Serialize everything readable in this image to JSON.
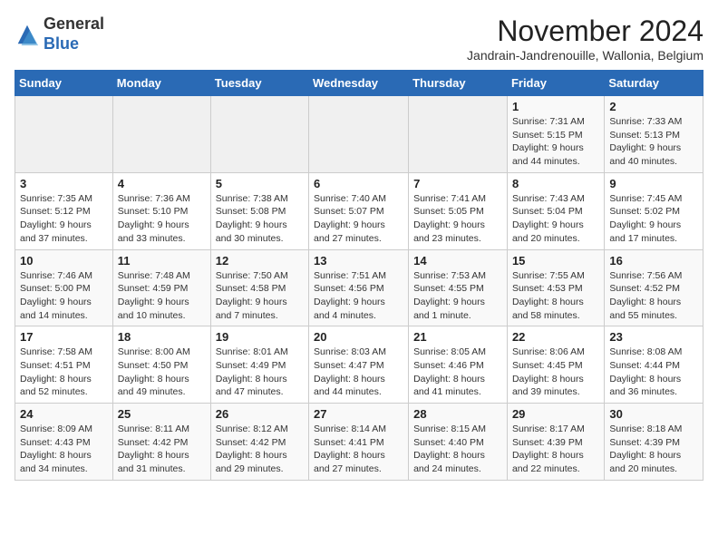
{
  "logo": {
    "general": "General",
    "blue": "Blue"
  },
  "title": "November 2024",
  "subtitle": "Jandrain-Jandrenouille, Wallonia, Belgium",
  "days_header": [
    "Sunday",
    "Monday",
    "Tuesday",
    "Wednesday",
    "Thursday",
    "Friday",
    "Saturday"
  ],
  "weeks": [
    [
      {
        "day": "",
        "info": ""
      },
      {
        "day": "",
        "info": ""
      },
      {
        "day": "",
        "info": ""
      },
      {
        "day": "",
        "info": ""
      },
      {
        "day": "",
        "info": ""
      },
      {
        "day": "1",
        "info": "Sunrise: 7:31 AM\nSunset: 5:15 PM\nDaylight: 9 hours\nand 44 minutes."
      },
      {
        "day": "2",
        "info": "Sunrise: 7:33 AM\nSunset: 5:13 PM\nDaylight: 9 hours\nand 40 minutes."
      }
    ],
    [
      {
        "day": "3",
        "info": "Sunrise: 7:35 AM\nSunset: 5:12 PM\nDaylight: 9 hours\nand 37 minutes."
      },
      {
        "day": "4",
        "info": "Sunrise: 7:36 AM\nSunset: 5:10 PM\nDaylight: 9 hours\nand 33 minutes."
      },
      {
        "day": "5",
        "info": "Sunrise: 7:38 AM\nSunset: 5:08 PM\nDaylight: 9 hours\nand 30 minutes."
      },
      {
        "day": "6",
        "info": "Sunrise: 7:40 AM\nSunset: 5:07 PM\nDaylight: 9 hours\nand 27 minutes."
      },
      {
        "day": "7",
        "info": "Sunrise: 7:41 AM\nSunset: 5:05 PM\nDaylight: 9 hours\nand 23 minutes."
      },
      {
        "day": "8",
        "info": "Sunrise: 7:43 AM\nSunset: 5:04 PM\nDaylight: 9 hours\nand 20 minutes."
      },
      {
        "day": "9",
        "info": "Sunrise: 7:45 AM\nSunset: 5:02 PM\nDaylight: 9 hours\nand 17 minutes."
      }
    ],
    [
      {
        "day": "10",
        "info": "Sunrise: 7:46 AM\nSunset: 5:00 PM\nDaylight: 9 hours\nand 14 minutes."
      },
      {
        "day": "11",
        "info": "Sunrise: 7:48 AM\nSunset: 4:59 PM\nDaylight: 9 hours\nand 10 minutes."
      },
      {
        "day": "12",
        "info": "Sunrise: 7:50 AM\nSunset: 4:58 PM\nDaylight: 9 hours\nand 7 minutes."
      },
      {
        "day": "13",
        "info": "Sunrise: 7:51 AM\nSunset: 4:56 PM\nDaylight: 9 hours\nand 4 minutes."
      },
      {
        "day": "14",
        "info": "Sunrise: 7:53 AM\nSunset: 4:55 PM\nDaylight: 9 hours\nand 1 minute."
      },
      {
        "day": "15",
        "info": "Sunrise: 7:55 AM\nSunset: 4:53 PM\nDaylight: 8 hours\nand 58 minutes."
      },
      {
        "day": "16",
        "info": "Sunrise: 7:56 AM\nSunset: 4:52 PM\nDaylight: 8 hours\nand 55 minutes."
      }
    ],
    [
      {
        "day": "17",
        "info": "Sunrise: 7:58 AM\nSunset: 4:51 PM\nDaylight: 8 hours\nand 52 minutes."
      },
      {
        "day": "18",
        "info": "Sunrise: 8:00 AM\nSunset: 4:50 PM\nDaylight: 8 hours\nand 49 minutes."
      },
      {
        "day": "19",
        "info": "Sunrise: 8:01 AM\nSunset: 4:49 PM\nDaylight: 8 hours\nand 47 minutes."
      },
      {
        "day": "20",
        "info": "Sunrise: 8:03 AM\nSunset: 4:47 PM\nDaylight: 8 hours\nand 44 minutes."
      },
      {
        "day": "21",
        "info": "Sunrise: 8:05 AM\nSunset: 4:46 PM\nDaylight: 8 hours\nand 41 minutes."
      },
      {
        "day": "22",
        "info": "Sunrise: 8:06 AM\nSunset: 4:45 PM\nDaylight: 8 hours\nand 39 minutes."
      },
      {
        "day": "23",
        "info": "Sunrise: 8:08 AM\nSunset: 4:44 PM\nDaylight: 8 hours\nand 36 minutes."
      }
    ],
    [
      {
        "day": "24",
        "info": "Sunrise: 8:09 AM\nSunset: 4:43 PM\nDaylight: 8 hours\nand 34 minutes."
      },
      {
        "day": "25",
        "info": "Sunrise: 8:11 AM\nSunset: 4:42 PM\nDaylight: 8 hours\nand 31 minutes."
      },
      {
        "day": "26",
        "info": "Sunrise: 8:12 AM\nSunset: 4:42 PM\nDaylight: 8 hours\nand 29 minutes."
      },
      {
        "day": "27",
        "info": "Sunrise: 8:14 AM\nSunset: 4:41 PM\nDaylight: 8 hours\nand 27 minutes."
      },
      {
        "day": "28",
        "info": "Sunrise: 8:15 AM\nSunset: 4:40 PM\nDaylight: 8 hours\nand 24 minutes."
      },
      {
        "day": "29",
        "info": "Sunrise: 8:17 AM\nSunset: 4:39 PM\nDaylight: 8 hours\nand 22 minutes."
      },
      {
        "day": "30",
        "info": "Sunrise: 8:18 AM\nSunset: 4:39 PM\nDaylight: 8 hours\nand 20 minutes."
      }
    ]
  ]
}
